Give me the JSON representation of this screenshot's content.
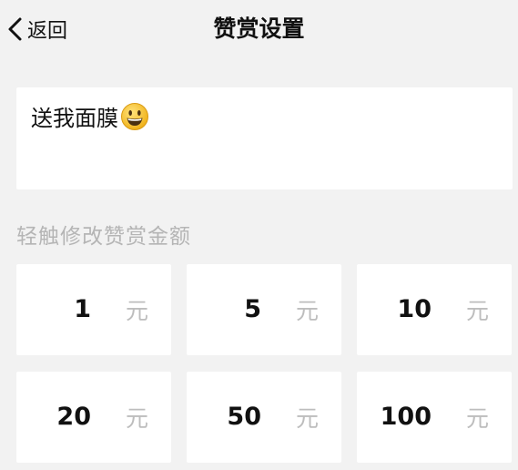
{
  "header": {
    "back_label": "返回",
    "title": "赞赏设置"
  },
  "message": {
    "text": "送我面膜",
    "emoji": "grinning-face-emoji"
  },
  "hint": "轻触修改赞赏金额",
  "amounts": [
    {
      "value": "1",
      "unit": "元"
    },
    {
      "value": "5",
      "unit": "元"
    },
    {
      "value": "10",
      "unit": "元"
    },
    {
      "value": "20",
      "unit": "元"
    },
    {
      "value": "50",
      "unit": "元"
    },
    {
      "value": "100",
      "unit": "元"
    }
  ],
  "colors": {
    "background": "#f2f2f2",
    "card": "#ffffff",
    "hint_text": "#b5b5b5",
    "unit_text": "#bdbdbd",
    "emoji_yellow": "#f7c52b"
  }
}
